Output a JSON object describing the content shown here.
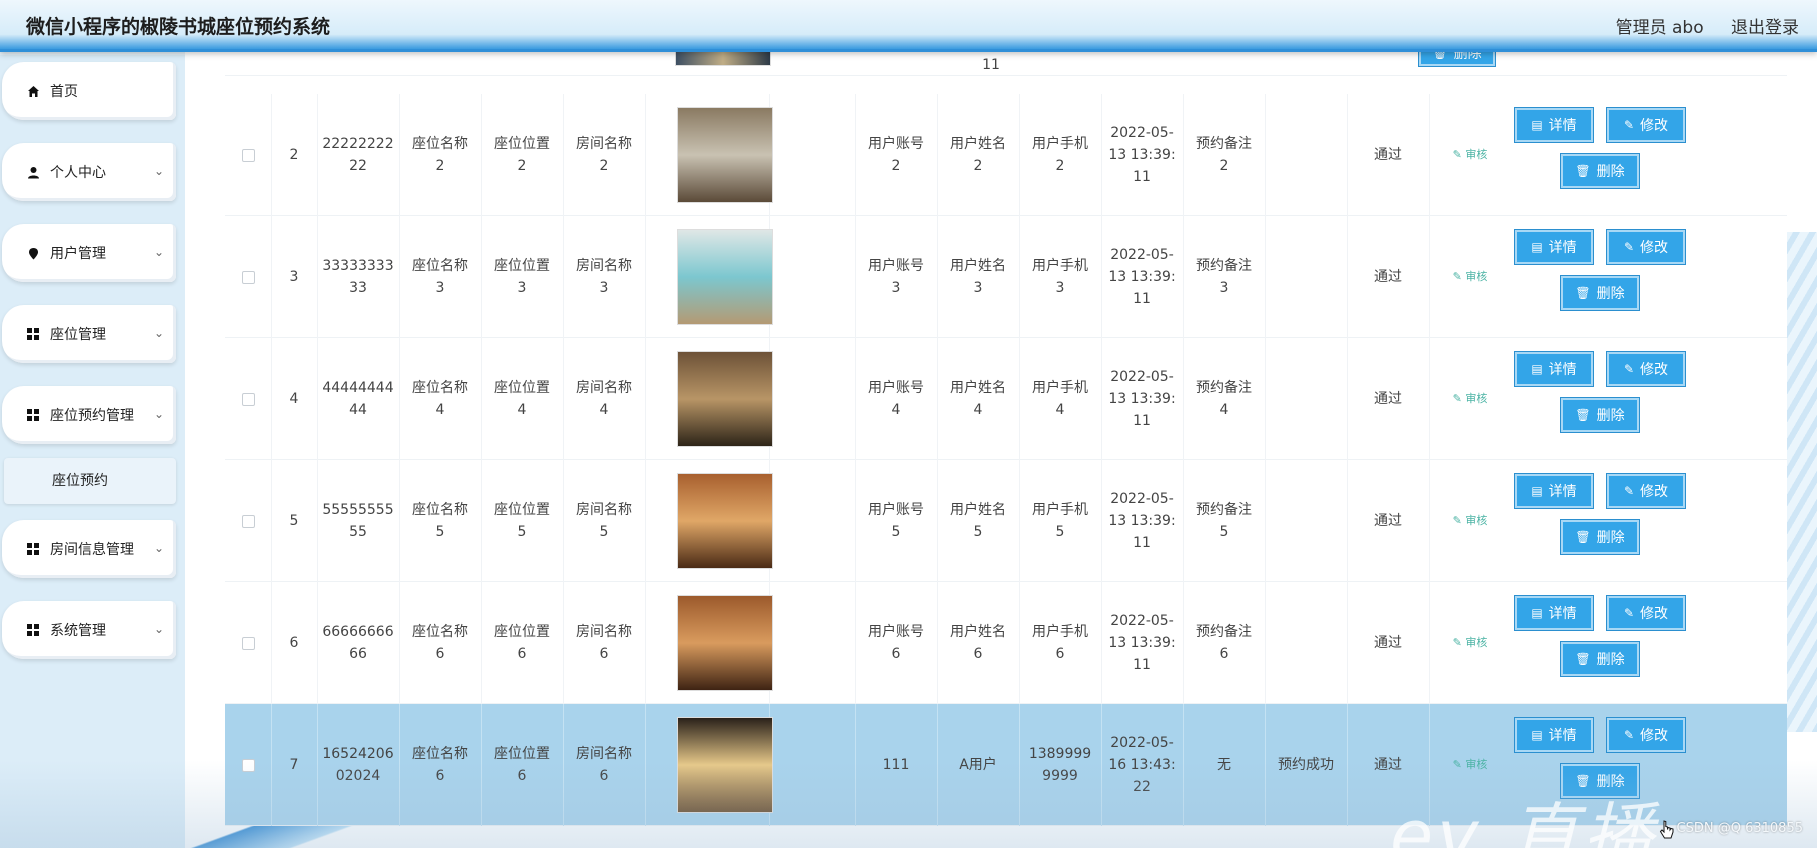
{
  "header": {
    "app_title": "微信小程序的椒陵书城座位预约系统",
    "admin_label": "管理员 abo",
    "logout_label": "退出登录"
  },
  "sidebar": {
    "items": [
      {
        "label": "首页",
        "icon": "home-icon"
      },
      {
        "label": "个人中心",
        "icon": "user-icon"
      },
      {
        "label": "用户管理",
        "icon": "pin-icon"
      },
      {
        "label": "座位管理",
        "icon": "grid-icon"
      },
      {
        "label": "座位预约管理",
        "icon": "grid-icon"
      },
      {
        "label": "房间信息管理",
        "icon": "grid-icon"
      },
      {
        "label": "系统管理",
        "icon": "grid-icon"
      }
    ],
    "sub_item": "座位预约"
  },
  "table": {
    "top_partial": {
      "time_tail": "11",
      "delete_label": "删除"
    },
    "rows": [
      {
        "idx": "2",
        "order_no": "22222222\n22",
        "seat_name": "座位名称\n2",
        "seat_pos": "座位位置\n2",
        "room_name": "房间名称\n2",
        "account": "用户账号\n2",
        "username": "用户姓名\n2",
        "phone": "用户手机\n2",
        "time": "2022-05-\n13 13:39:\n11",
        "remark": "预约备注\n2",
        "status": "",
        "review": "通过",
        "approve": "审核"
      },
      {
        "idx": "3",
        "order_no": "33333333\n33",
        "seat_name": "座位名称\n3",
        "seat_pos": "座位位置\n3",
        "room_name": "房间名称\n3",
        "account": "用户账号\n3",
        "username": "用户姓名\n3",
        "phone": "用户手机\n3",
        "time": "2022-05-\n13 13:39:\n11",
        "remark": "预约备注\n3",
        "status": "",
        "review": "通过",
        "approve": "审核"
      },
      {
        "idx": "4",
        "order_no": "44444444\n44",
        "seat_name": "座位名称\n4",
        "seat_pos": "座位位置\n4",
        "room_name": "房间名称\n4",
        "account": "用户账号\n4",
        "username": "用户姓名\n4",
        "phone": "用户手机\n4",
        "time": "2022-05-\n13 13:39:\n11",
        "remark": "预约备注\n4",
        "status": "",
        "review": "通过",
        "approve": "审核"
      },
      {
        "idx": "5",
        "order_no": "55555555\n55",
        "seat_name": "座位名称\n5",
        "seat_pos": "座位位置\n5",
        "room_name": "房间名称\n5",
        "account": "用户账号\n5",
        "username": "用户姓名\n5",
        "phone": "用户手机\n5",
        "time": "2022-05-\n13 13:39:\n11",
        "remark": "预约备注\n5",
        "status": "",
        "review": "通过",
        "approve": "审核"
      },
      {
        "idx": "6",
        "order_no": "66666666\n66",
        "seat_name": "座位名称\n6",
        "seat_pos": "座位位置\n6",
        "room_name": "房间名称\n6",
        "account": "用户账号\n6",
        "username": "用户姓名\n6",
        "phone": "用户手机\n6",
        "time": "2022-05-\n13 13:39:\n11",
        "remark": "预约备注\n6",
        "status": "",
        "review": "通过",
        "approve": "审核"
      },
      {
        "idx": "7",
        "order_no": "16524206\n02024",
        "seat_name": "座位名称\n6",
        "seat_pos": "座位位置\n6",
        "room_name": "房间名称\n6",
        "account": "111",
        "username": "A用户",
        "phone": "1389999\n9999",
        "time": "2022-05-\n16 13:43:\n22",
        "remark": "无",
        "status": "预约成功",
        "review": "通过",
        "approve": "审核"
      }
    ],
    "buttons": {
      "detail": "详情",
      "edit": "修改",
      "delete": "删除"
    },
    "thumb_colors": [
      [
        "#8a7a62",
        "#c9c2b2",
        "#5b4a38"
      ],
      [
        "#dfe7e6",
        "#7cc7cf",
        "#b49a73"
      ],
      [
        "#6d5238",
        "#b89566",
        "#2d2418"
      ],
      [
        "#a8602f",
        "#e0a767",
        "#4a2a15"
      ],
      [
        "#9c5a2c",
        "#d99b5e",
        "#3e2313"
      ],
      [
        "#2a211a",
        "#e7c98a",
        "#6e5030"
      ]
    ]
  },
  "watermark": "CSDN @Q 6310855",
  "logo_text": "ev 直播"
}
